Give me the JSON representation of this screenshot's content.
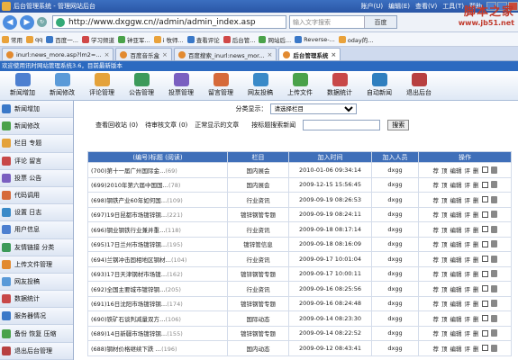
{
  "browser": {
    "title": "后台管理系统 - 管理网站后台",
    "menu": [
      "账户(U)",
      "编辑(E)",
      "查看(V)",
      "工具(T)",
      "帮助"
    ],
    "address": "http://www.dxggw.cn//admin/admin_index.asp",
    "search_placeholder": "输入文字搜索",
    "search_engine": "百度"
  },
  "watermark": {
    "line1": "脚本之家",
    "line2": "www.jb51.net"
  },
  "favorites": [
    {
      "label": "常用",
      "icon": "folder-icon"
    },
    {
      "label": "qq",
      "icon": "folder-icon"
    },
    {
      "label": "百度一...",
      "icon": "baidu-icon"
    },
    {
      "label": "学习频道",
      "icon": "page-icon"
    },
    {
      "label": "钟亚军...",
      "icon": "page-icon"
    },
    {
      "label": "i 牧师...",
      "icon": "page-icon"
    },
    {
      "label": "查看评论",
      "icon": "page-icon"
    },
    {
      "label": "后台管...",
      "icon": "page-icon"
    },
    {
      "label": "网站后...",
      "icon": "page-icon"
    },
    {
      "label": "Reverse-...",
      "icon": "page-icon"
    },
    {
      "label": "oday的...",
      "icon": "page-icon"
    }
  ],
  "tabs": [
    {
      "label": "inurl:news_more.asp?lm2=...",
      "active": false
    },
    {
      "label": "百度音乐盒",
      "active": false
    },
    {
      "label": "百度搜索_inurl:news_mor...",
      "active": false
    },
    {
      "label": "后台管理系统",
      "active": true
    }
  ],
  "notice": "欢迎使用讯时网站管理系统3.6，目前最新版本",
  "toolbar": [
    {
      "label": "新闻增加",
      "icon": "add-news-icon",
      "color": "#4c7fd0"
    },
    {
      "label": "新闻修改",
      "icon": "edit-news-icon",
      "color": "#5a9ad8"
    },
    {
      "label": "评论管理",
      "icon": "comment-icon",
      "color": "#e4a23a"
    },
    {
      "label": "公告管理",
      "icon": "notice-icon",
      "color": "#3c9a5a"
    },
    {
      "label": "投票管理",
      "icon": "vote-icon",
      "color": "#7a5fc0"
    },
    {
      "label": "留言管理",
      "icon": "message-icon",
      "color": "#d66a3a"
    },
    {
      "label": "网友投稿",
      "icon": "submit-icon",
      "color": "#3a8ac8"
    },
    {
      "label": "上传文件",
      "icon": "upload-icon",
      "color": "#4aa24a"
    },
    {
      "label": "数据统计",
      "icon": "stats-icon",
      "color": "#c84848"
    },
    {
      "label": "自动新闻",
      "icon": "auto-news-icon",
      "color": "#2f7fbf"
    },
    {
      "label": "退出后台",
      "icon": "exit-icon",
      "color": "#b84040"
    }
  ],
  "sidebar": [
    {
      "label": "新闻增加",
      "icon": "add-news-icon"
    },
    {
      "label": "新闻修改",
      "icon": "edit-news-icon"
    },
    {
      "label": "栏目 专题",
      "icon": "column-icon"
    },
    {
      "label": "评论 留言",
      "icon": "comment-icon"
    },
    {
      "label": "投票 公告",
      "icon": "vote-icon"
    },
    {
      "label": "代码调用",
      "icon": "code-icon"
    },
    {
      "label": "设置 日志",
      "icon": "settings-icon"
    },
    {
      "label": "用户信息",
      "icon": "user-icon"
    },
    {
      "label": "友情链接 分类",
      "icon": "link-icon"
    },
    {
      "label": "上传文件管理",
      "icon": "upload-icon"
    },
    {
      "label": "网友投稿",
      "icon": "submit-icon"
    },
    {
      "label": "数据统计",
      "icon": "stats-icon"
    },
    {
      "label": "服务器情况",
      "icon": "server-icon"
    },
    {
      "label": "备份 恢复 压缩",
      "icon": "backup-icon"
    },
    {
      "label": "退出后台管理",
      "icon": "exit-icon"
    }
  ],
  "main": {
    "filter_label": "分类显示：",
    "filter_value": "请选择栏目",
    "view_links": [
      "查看回收站 (0)",
      "待审核文章 (0)",
      "正常显示的文章"
    ],
    "search_label": "按标题搜索新闻",
    "search_button": "搜索",
    "columns": [
      "(编号)标题 (阅读)",
      "栏目",
      "加入时间",
      "加入人员",
      "操作"
    ],
    "ops": [
      "荐",
      "顶",
      "编辑",
      "评",
      "删"
    ],
    "rows": [
      {
        "id": "(700)",
        "title": "第十一届广州国际金…",
        "hits": "(69)",
        "column": "国内展会",
        "time": "2010-01-06 09:34:14",
        "user": "dxgg"
      },
      {
        "id": "(699)",
        "title": "2010年第六届中国国…",
        "hits": "(78)",
        "column": "国内展会",
        "time": "2009-12-15 15:56:45",
        "user": "dxgg"
      },
      {
        "id": "(698)",
        "title": "钢铁产业60年如何国…",
        "hits": "(109)",
        "column": "行业资讯",
        "time": "2009-09-19 08:26:53",
        "user": "dxgg"
      },
      {
        "id": "(697)",
        "title": "19日昆都市场镀锌钢…",
        "hits": "(221)",
        "column": "镀锌钢管专题",
        "time": "2009-09-19 08:24:11",
        "user": "dxgg"
      },
      {
        "id": "(696)",
        "title": "钢业钢铁行业兼并重…",
        "hits": "(118)",
        "column": "行业资讯",
        "time": "2009-09-18 08:17:14",
        "user": "dxgg"
      },
      {
        "id": "(695)",
        "title": "17日兰州市场镀锌钢…",
        "hits": "(195)",
        "column": "镀锌管信息",
        "time": "2009-09-18 08:16:09",
        "user": "dxgg"
      },
      {
        "id": "(694)",
        "title": "兰钢冲击固相地区钢材…",
        "hits": "(104)",
        "column": "行业资讯",
        "time": "2009-09-17 10:01:04",
        "user": "dxgg"
      },
      {
        "id": "(693)",
        "title": "17日天津钢材市场镀…",
        "hits": "(162)",
        "column": "镀锌钢管专题",
        "time": "2009-09-17 10:00:11",
        "user": "dxgg"
      },
      {
        "id": "(692)",
        "title": "全国主要城市镀锌钢…",
        "hits": "(205)",
        "column": "行业资讯",
        "time": "2009-09-16 08:25:56",
        "user": "dxgg"
      },
      {
        "id": "(691)",
        "title": "16日沈阳市场镀锌钢…",
        "hits": "(174)",
        "column": "镀锌钢管专题",
        "time": "2009-09-16 08:24:48",
        "user": "dxgg"
      },
      {
        "id": "(690)",
        "title": "铁矿石谈判减量双方…",
        "hits": "(106)",
        "column": "国际动态",
        "time": "2009-09-14 08:23:30",
        "user": "dxgg"
      },
      {
        "id": "(689)",
        "title": "14日新疆市场镀锌钢…",
        "hits": "(155)",
        "column": "镀锌钢管专题",
        "time": "2009-09-14 08:22:52",
        "user": "dxgg"
      },
      {
        "id": "(688)",
        "title": "钢材价格继续下跌 …",
        "hits": "(196)",
        "column": "国内动态",
        "time": "2009-09-12 08:43:41",
        "user": "dxgg"
      }
    ]
  }
}
